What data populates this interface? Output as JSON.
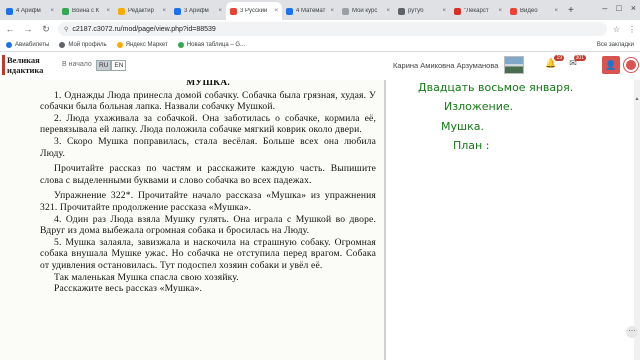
{
  "browser": {
    "tabs": [
      {
        "label": "4 Арифм",
        "color": "#1a73e8"
      },
      {
        "label": "Война с К",
        "color": "#34a853"
      },
      {
        "label": "Редактир",
        "color": "#f9ab00"
      },
      {
        "label": "3 Арифм",
        "color": "#1a73e8"
      },
      {
        "label": "3 Русский",
        "color": "#ea4335",
        "active": true
      },
      {
        "label": "4 Математ",
        "color": "#1a73e8"
      },
      {
        "label": "Мои курс",
        "color": "#9aa0a6"
      },
      {
        "label": "рутуб",
        "color": "#5f6368"
      },
      {
        "label": "\"Лекарст",
        "color": "#d93025"
      },
      {
        "label": "Видео",
        "color": "#ea4335"
      }
    ],
    "tab_close": "×",
    "new_tab": "+",
    "window_controls": [
      "–",
      "□",
      "×"
    ],
    "url": "c2187.c3072.ru/mod/page/view.php?id=88539",
    "nav": [
      "←",
      "→",
      "↻"
    ],
    "toolbar_icons": [
      "☆",
      "⋮"
    ],
    "bookmarks": [
      {
        "label": "Авиабилеты",
        "color": "#1a73e8"
      },
      {
        "label": "Мой профиль",
        "color": "#5f6368"
      },
      {
        "label": "Яндекс Маркет",
        "color": "#f9ab00"
      },
      {
        "label": "Новая таблица – G...",
        "color": "#34a853"
      }
    ],
    "bookmarks_right": "Все закладки"
  },
  "site": {
    "logo": "Великая идактика",
    "home": "В начало",
    "lang_ru": "RU",
    "lang_en": "EN",
    "user": "Карина Амиковна Арзуманова",
    "notif_count": "19",
    "msg_count": "301",
    "accent": "#d9534f"
  },
  "document": {
    "title": "МУШКА.",
    "paragraphs": [
      "1. Однажды Люда принесла домой собачку. Собачка была грязная, худая. У собачки была больная лапка. Назвали собачку Мушкой.",
      "2. Люда ухаживала за собачкой. Она заботилась о собачке, кормила её, перевязывала ей лапку. Люда положила собачке мягкий коврик около двери.",
      "3. Скоро Мушка поправилась, стала весёлая. Больше всех она любила Люду.",
      "Прочитайте рассказ по частям и расскажите каждую часть. Выпишите слова с выделенными буквами и слово собачка во всех падежах.",
      "Упражнение 322*. Прочитайте начало рассказа «Мушка» из упражнения 321. Прочитайте продолжение рассказа «Мушка».",
      "4. Один раз Люда взяла Мушку гулять. Она играла с Мушкой во дворе. Вдруг из дома выбежала огромная собака и бросилась на Люду.",
      "5. Мушка залаяла, завизжала и наскочила на страшную собаку. Огромная собака внушала Мушке ужас. Но собачка не отступила перед врагом. Собака от удивления остановилась. Тут подоспел хозяин собаки и увёл её.",
      "Так маленькая Мушка спасла свою хозяйку.",
      "Расскажите весь рассказ «Мушка»."
    ]
  },
  "notes": {
    "date": "Двадцать восьмое января.",
    "type": "Изложение.",
    "title": "Мушка.",
    "plan": "План :",
    "color": "#137a13"
  }
}
